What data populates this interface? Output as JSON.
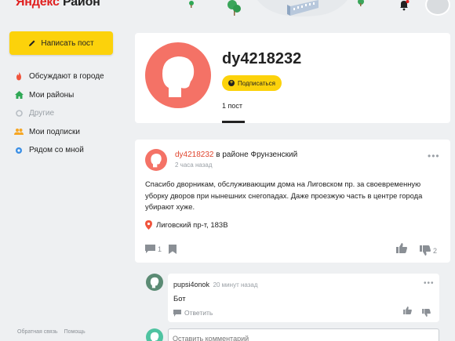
{
  "header": {
    "logo_ya": "Яндекс",
    "logo_rest": "Район"
  },
  "sidebar": {
    "write_label": "Написать пост",
    "items": [
      {
        "label": "Обсуждают в городе",
        "icon": "fire-icon",
        "color": "#f0543c"
      },
      {
        "label": "Мои районы",
        "icon": "home-icon",
        "color": "#2fa855"
      },
      {
        "label": "Другие",
        "icon": "circle-icon",
        "color": "#b8bec4"
      },
      {
        "label": "Мои подписки",
        "icon": "people-icon",
        "color": "#f6a623"
      },
      {
        "label": "Рядом со мной",
        "icon": "location-dot-icon",
        "color": "#3b8fe5"
      }
    ],
    "footer": [
      "Обратная связь",
      "Помощь"
    ]
  },
  "profile": {
    "username": "dy4218232",
    "subscribe_label": "Подписаться",
    "posts_tab": "1 пост",
    "avatar_color": "#f47266"
  },
  "post": {
    "author": "dy4218232",
    "district_prefix": "в районе Фрунзенский",
    "time": "2 часа назад",
    "text": "Спасибо дворникам, обслуживающим дома на Лиговском пр. за своевременную уборку дворов при нынешних снегопадах. Даже проезжую часть в центре города убирают хуже.",
    "address": "Лиговский пр-т, 183В",
    "comments_count": "1",
    "dislikes_count": "2"
  },
  "comment": {
    "author": "pupsi4onok",
    "time": "20 минут назад",
    "text": "Бот",
    "reply_label": "Ответить"
  },
  "new_comment": {
    "placeholder": "Оставить комментарий"
  },
  "colors": {
    "accent_yellow": "#fcd20b",
    "author_red": "#e0452e",
    "background": "#eef0f2"
  }
}
